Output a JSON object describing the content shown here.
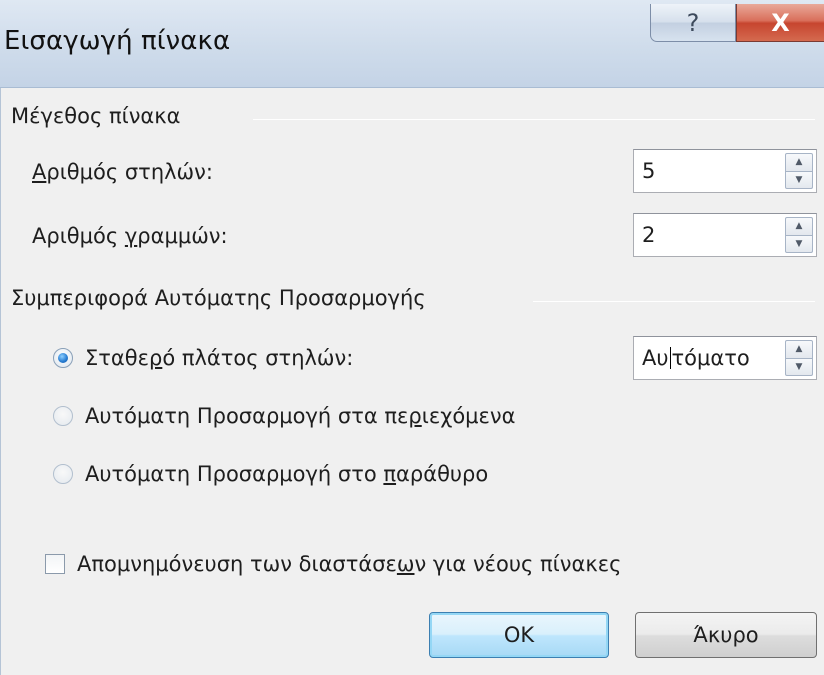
{
  "window": {
    "title": "Εισαγωγή πίνακα",
    "help_glyph": "?",
    "close_glyph": "X"
  },
  "table_size": {
    "header": "Μέγεθος πίνακα",
    "columns_label_pre": "",
    "columns_label_ul": "Α",
    "columns_label_post": "ριθμός στηλών:",
    "columns_value": "5",
    "rows_label_pre": "Αριθμός ",
    "rows_label_ul": "γ",
    "rows_label_post": "ραμμών:",
    "rows_value": "2"
  },
  "autofit": {
    "header": "Συμπεριφορά Αυτόματης Προσαρμογής",
    "fixed_label_pre": "Σταθε",
    "fixed_label_ul": "ρ",
    "fixed_label_post": "ό πλάτος στηλών:",
    "fixed_value_pre": "Αυ",
    "fixed_value_post": "τόματο",
    "contents_label_pre": "Αυτόματη Προσαρμογή στα πε",
    "contents_label_ul": "ρ",
    "contents_label_post": "ιεχόμενα",
    "window_label_pre": "Αυτόματη Προσαρμογή στο ",
    "window_label_ul": "π",
    "window_label_post": "αράθυρο",
    "selected": "fixed"
  },
  "remember": {
    "label_pre": "Απομνημόνευση των διαστάσε",
    "label_ul": "ω",
    "label_post": "ν για νέους πίνακες",
    "checked": false
  },
  "buttons": {
    "ok": "OK",
    "cancel": "Άκυρο"
  },
  "colors": {
    "titlebar": "#cfdceb",
    "client_bg": "#f0f0f0",
    "close_button": "#c7452f",
    "default_button_border": "#3c7fb1"
  }
}
